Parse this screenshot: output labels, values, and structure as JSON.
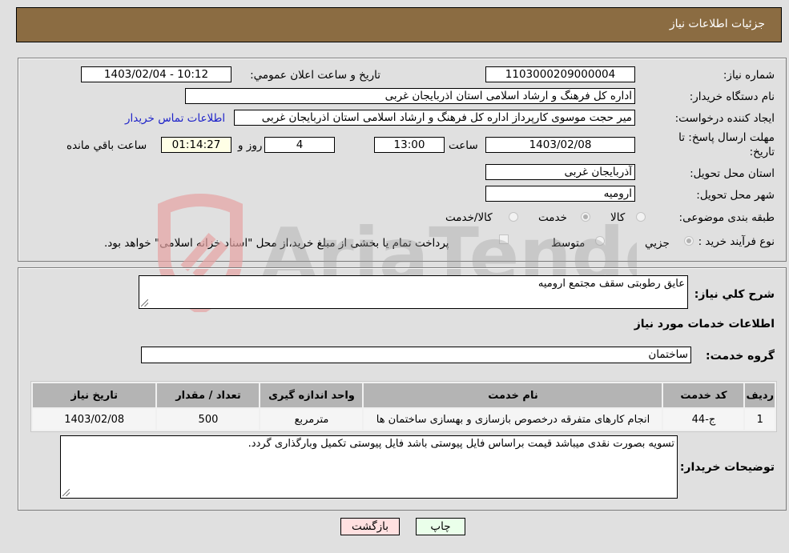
{
  "header": {
    "title": "جزئیات اطلاعات نیاز"
  },
  "form": {
    "need_number": {
      "label": "شماره نیاز:",
      "value": "1103000209000004"
    },
    "announce_datetime": {
      "label": "تاريخ و ساعت اعلان عمومي:",
      "value": "1403/02/04 - 10:12"
    },
    "buyer_org": {
      "label": "نام دستگاه خريدار:",
      "value": "اداره کل فرهنگ و ارشاد اسلامی استان اذربایجان غربی"
    },
    "requester": {
      "label": "ایجاد کننده درخواست:",
      "value": "میر حجت موسوی کارپرداز اداره کل فرهنگ و ارشاد اسلامی استان اذربایجان غربی",
      "contact_link": "اطلاعات تماس خریدار"
    },
    "deadline": {
      "label_line1": "مهلت ارسال پاسخ: تا",
      "label_line2": "تاریخ:",
      "date": "1403/02/08",
      "time_label": "ساعت",
      "time": "13:00",
      "days": "4",
      "days_suffix": "روز و",
      "remaining": "01:14:27",
      "remaining_suffix": "ساعت باقي مانده"
    },
    "delivery_province": {
      "label": "استان محل تحویل:",
      "value": "آذربایجان غربی"
    },
    "delivery_city": {
      "label": "شهر محل تحویل:",
      "value": "ارومیه"
    },
    "category": {
      "label": "طبقه بندی موضوعی:",
      "options": [
        {
          "label": "کالا",
          "selected": false
        },
        {
          "label": "خدمت",
          "selected": true
        },
        {
          "label": "کالا/خدمت",
          "selected": false
        }
      ]
    },
    "purchase_type": {
      "label": "نوع فرآیند خرید :",
      "options": [
        {
          "label": "جزيي",
          "selected": true
        },
        {
          "label": "متوسط",
          "selected": false
        }
      ],
      "treasury_note": "پرداخت تمام یا بخشی از مبلغ خرید،از محل \"اسناد خزانه اسلامی\" خواهد بود.",
      "treasury_checked": false
    }
  },
  "details": {
    "description_label": "شرح کلي نياز:",
    "description_value": "عایق رطوبتی سقف مجتمع ارومیه",
    "services_heading": "اطلاعات خدمات مورد نیاز",
    "service_group_label": "گروه خدمت:",
    "service_group_value": "ساختمان",
    "table": {
      "headers": [
        "رديف",
        "کد خدمت",
        "نام خدمت",
        "واحد اندازه گیری",
        "تعداد / مقدار",
        "تاریخ نیاز"
      ],
      "rows": [
        [
          "1",
          "ج-44",
          "انجام کارهای متفرقه درخصوص بازسازی و بهسازی ساختمان ها",
          "مترمربع",
          "500",
          "1403/02/08"
        ]
      ]
    },
    "buyer_notes_label": "توضیحات خریدار:",
    "buyer_notes_value": "تسویه بصورت نقدی میباشد قیمت براساس فایل پیوستی باشد فایل پیوستی تکمیل وبارگذاری گردد."
  },
  "buttons": {
    "print": "چاپ",
    "back": "بازگشت"
  },
  "watermark": {
    "text": "AriaTender.neT"
  }
}
